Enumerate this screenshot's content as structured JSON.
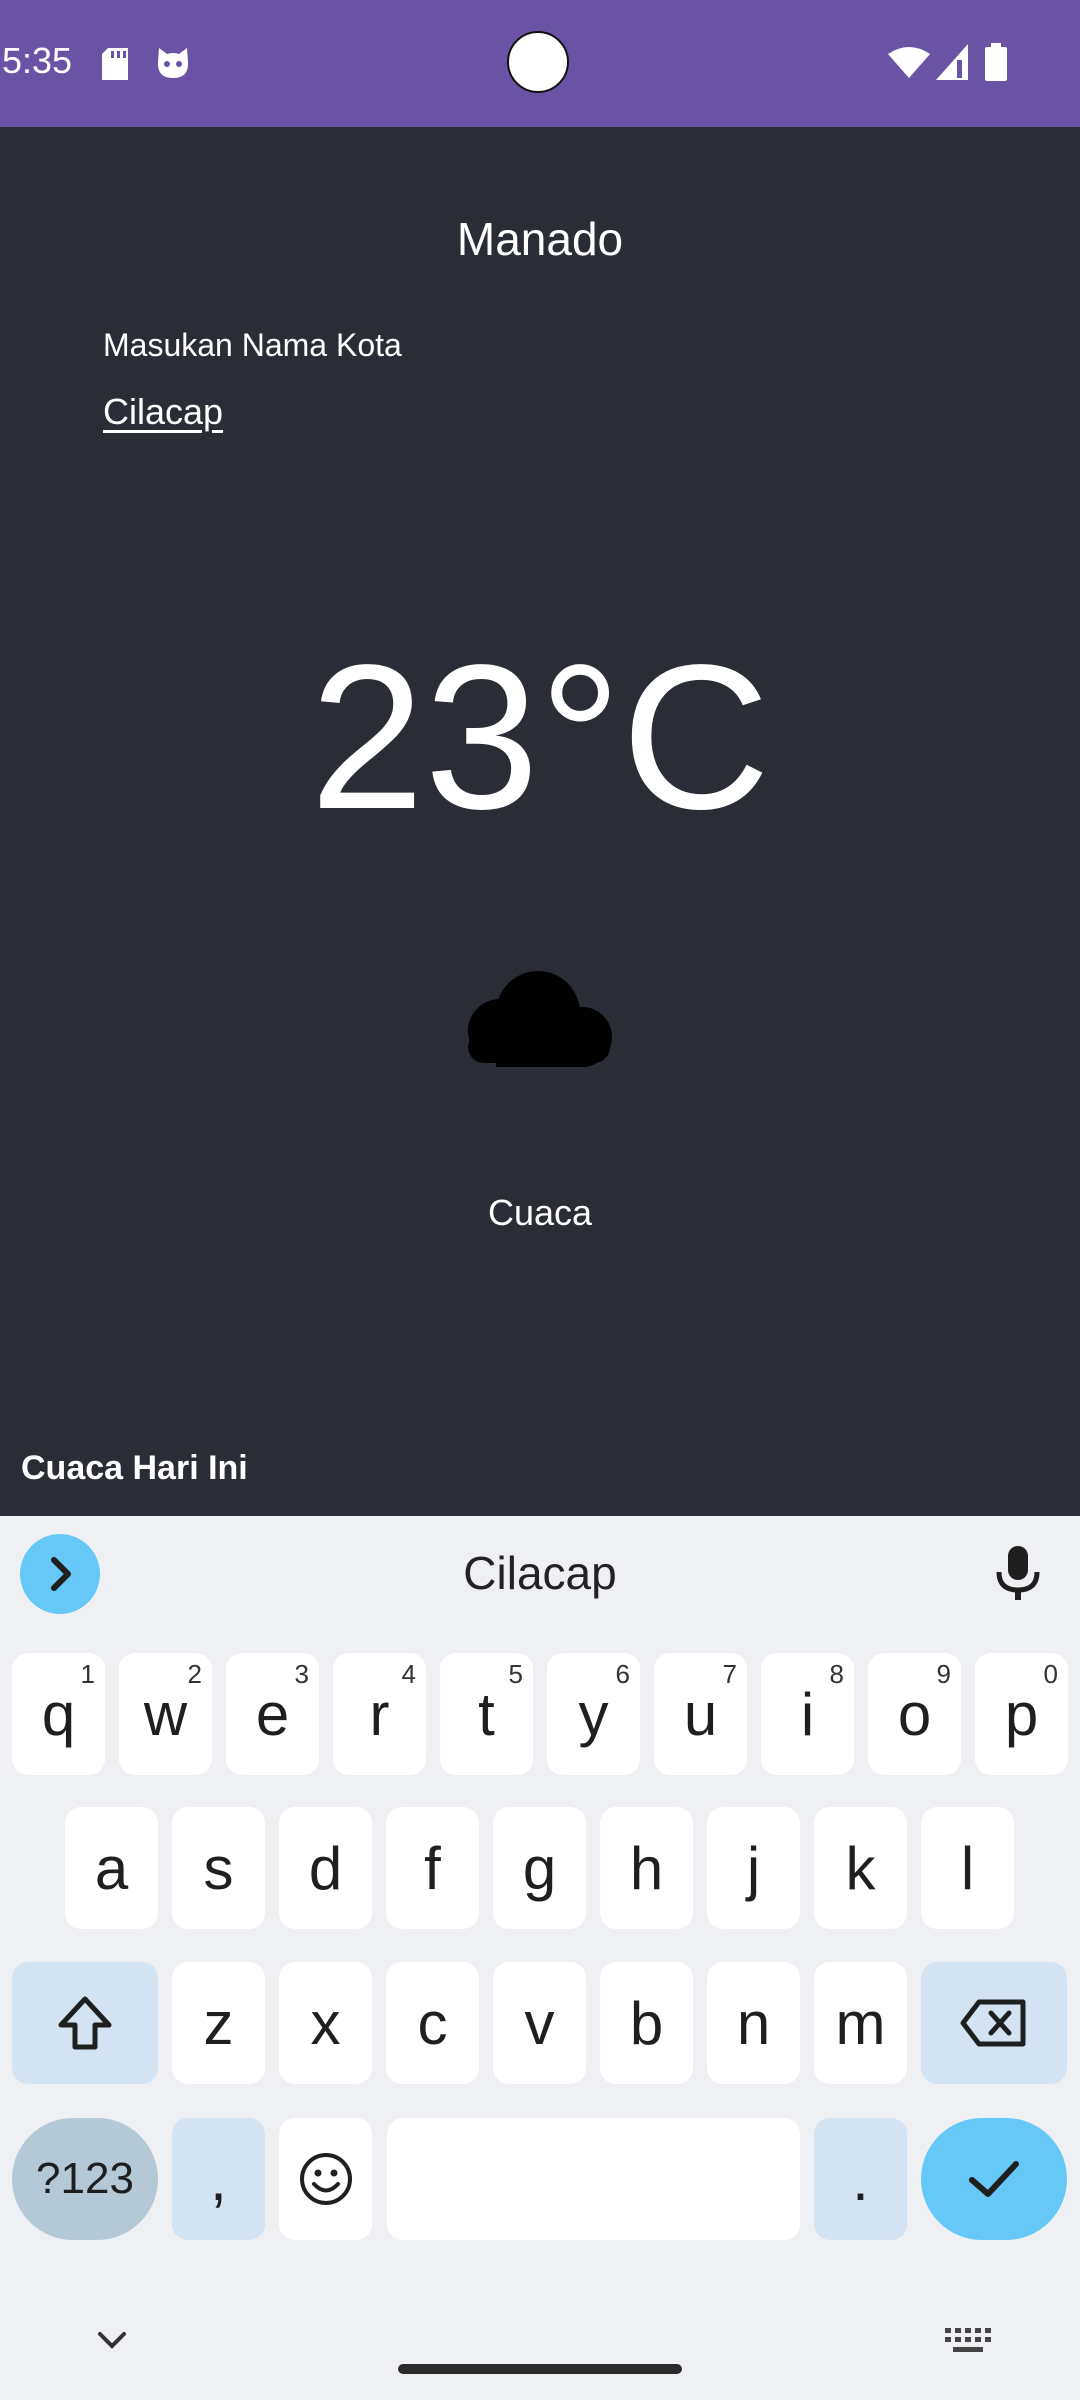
{
  "status_bar": {
    "time": "5:35",
    "icons": [
      "sd-card-icon",
      "cat-face-icon",
      "wifi-icon",
      "signal-icon",
      "battery-icon"
    ],
    "color": "#6a52a5"
  },
  "app": {
    "city_name": "Manado",
    "input_label": "Masukan Nama Kota",
    "input_value": "Cilacap",
    "temperature": "23°C",
    "weather_icon": "cloud-icon",
    "weather_description": "Cuaca",
    "section_title": "Cuaca Hari Ini",
    "background": "#2a2d36"
  },
  "keyboard": {
    "suggestion": "Cilacap",
    "row1": [
      {
        "key": "q",
        "hint": "1"
      },
      {
        "key": "w",
        "hint": "2"
      },
      {
        "key": "e",
        "hint": "3"
      },
      {
        "key": "r",
        "hint": "4"
      },
      {
        "key": "t",
        "hint": "5"
      },
      {
        "key": "y",
        "hint": "6"
      },
      {
        "key": "u",
        "hint": "7"
      },
      {
        "key": "i",
        "hint": "8"
      },
      {
        "key": "o",
        "hint": "9"
      },
      {
        "key": "p",
        "hint": "0"
      }
    ],
    "row2": [
      "a",
      "s",
      "d",
      "f",
      "g",
      "h",
      "j",
      "k",
      "l"
    ],
    "row3": [
      "z",
      "x",
      "c",
      "v",
      "b",
      "n",
      "m"
    ],
    "symbols_label": "?123",
    "comma": ",",
    "period": ".",
    "accent_color": "#66c8f6"
  }
}
